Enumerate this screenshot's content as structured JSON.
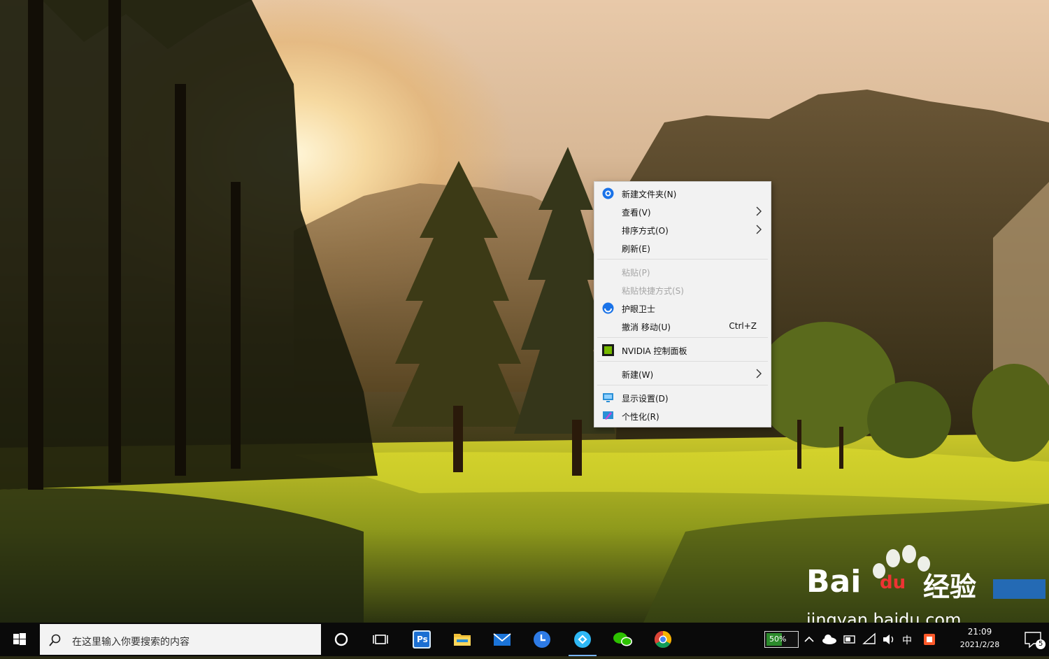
{
  "desktop": {
    "wallpaper": "forest-valley-sunset",
    "watermark": {
      "brand": "Bai",
      "paw": "du",
      "cn": "经验",
      "url": "jingyan.baidu.com"
    }
  },
  "context_menu": {
    "items": [
      {
        "label": "新建文件夹(N)",
        "icon": "shield-blue-icon"
      },
      {
        "label": "查看(V)",
        "submenu": true
      },
      {
        "label": "排序方式(O)",
        "submenu": true
      },
      {
        "label": "刷新(E)"
      },
      {
        "label": "粘贴(P)",
        "disabled": true
      },
      {
        "label": "粘贴快捷方式(S)",
        "disabled": true
      },
      {
        "label": "护眼卫士",
        "icon": "shield-blue-icon"
      },
      {
        "label": "撤消 移动(U)",
        "shortcut": "Ctrl+Z"
      },
      {
        "label": "NVIDIA 控制面板",
        "icon": "nvidia-icon"
      },
      {
        "label": "新建(W)",
        "submenu": true
      },
      {
        "label": "显示设置(D)",
        "icon": "display-icon"
      },
      {
        "label": "个性化(R)",
        "icon": "personalize-icon"
      }
    ]
  },
  "taskbar": {
    "search_placeholder": "在这里输入你要搜索的内容",
    "pinned": [
      "cortana-icon",
      "task-view-icon",
      "photoshop-icon",
      "file-explorer-icon",
      "mail-icon",
      "clock-app-icon",
      "browser-icon",
      "wechat-icon",
      "chrome-icon"
    ],
    "ps_label": "Ps",
    "battery_percent": "50%",
    "battery_level": 0.5,
    "clock_time": "21:09",
    "clock_date": "2021/2/28",
    "notification_count": "5",
    "ime_label": "中"
  },
  "colors": {
    "accent": "#0078d7",
    "menu_bg": "#f2f2f2",
    "taskbar": "#0a0a0a"
  }
}
